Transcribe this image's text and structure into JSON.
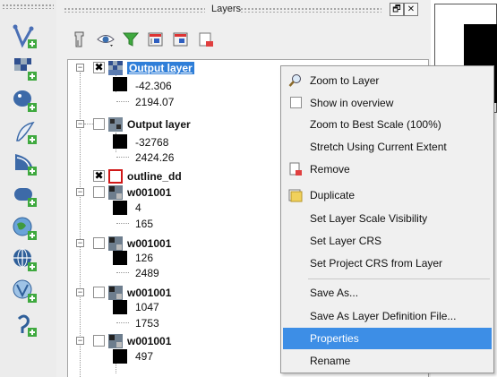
{
  "dock": {
    "title": "Layers",
    "float_btn": "🗗",
    "close_btn": "✕"
  },
  "tree": {
    "rows": [
      {
        "kind": "layer",
        "name": "Output layer",
        "bold": true,
        "selected": true,
        "checked": "✖"
      },
      {
        "kind": "value",
        "text": "-42.306"
      },
      {
        "kind": "value",
        "text": "2194.07"
      },
      {
        "kind": "layer",
        "name": "Output layer",
        "bold": true,
        "checked": ""
      },
      {
        "kind": "value",
        "text": "-32768"
      },
      {
        "kind": "value",
        "text": "2424.26"
      },
      {
        "kind": "layer",
        "name": "outline_dd",
        "bold": true,
        "checked": "✖"
      },
      {
        "kind": "layer",
        "name": "w001001",
        "bold": true,
        "checked": ""
      },
      {
        "kind": "value",
        "text": "4"
      },
      {
        "kind": "value",
        "text": "165"
      },
      {
        "kind": "layer",
        "name": "w001001",
        "bold": true,
        "checked": ""
      },
      {
        "kind": "value",
        "text": "126"
      },
      {
        "kind": "value",
        "text": "2489"
      },
      {
        "kind": "layer",
        "name": "w001001",
        "bold": true,
        "checked": ""
      },
      {
        "kind": "value",
        "text": "1047"
      },
      {
        "kind": "value",
        "text": "1753"
      },
      {
        "kind": "layer",
        "name": "w001001",
        "bold": true,
        "checked": ""
      },
      {
        "kind": "value",
        "text": "497"
      }
    ]
  },
  "menu": {
    "items": [
      {
        "label": "Zoom to Layer",
        "icon": "zoom-icon"
      },
      {
        "label": "Show in overview",
        "icon": "checkbox"
      },
      {
        "label": "Zoom to Best Scale (100%)",
        "icon": ""
      },
      {
        "label": "Stretch Using Current Extent",
        "icon": ""
      },
      {
        "label": "Remove",
        "icon": "remove-layer-icon"
      },
      {
        "label": "Duplicate",
        "icon": "duplicate-layer-icon"
      },
      {
        "label": "Set Layer Scale Visibility",
        "icon": ""
      },
      {
        "label": "Set Layer CRS",
        "icon": ""
      },
      {
        "label": "Set Project CRS from Layer",
        "icon": ""
      },
      {
        "label": "Save As...",
        "icon": ""
      },
      {
        "label": "Save As Layer Definition File...",
        "icon": ""
      },
      {
        "label": "Properties",
        "icon": "",
        "highlight": true
      },
      {
        "label": "Rename",
        "icon": ""
      }
    ]
  },
  "colors": {
    "selection": "#2f7ed8",
    "menu_highlight": "#3d8ee6",
    "toolbar_bg": "#ececec"
  }
}
